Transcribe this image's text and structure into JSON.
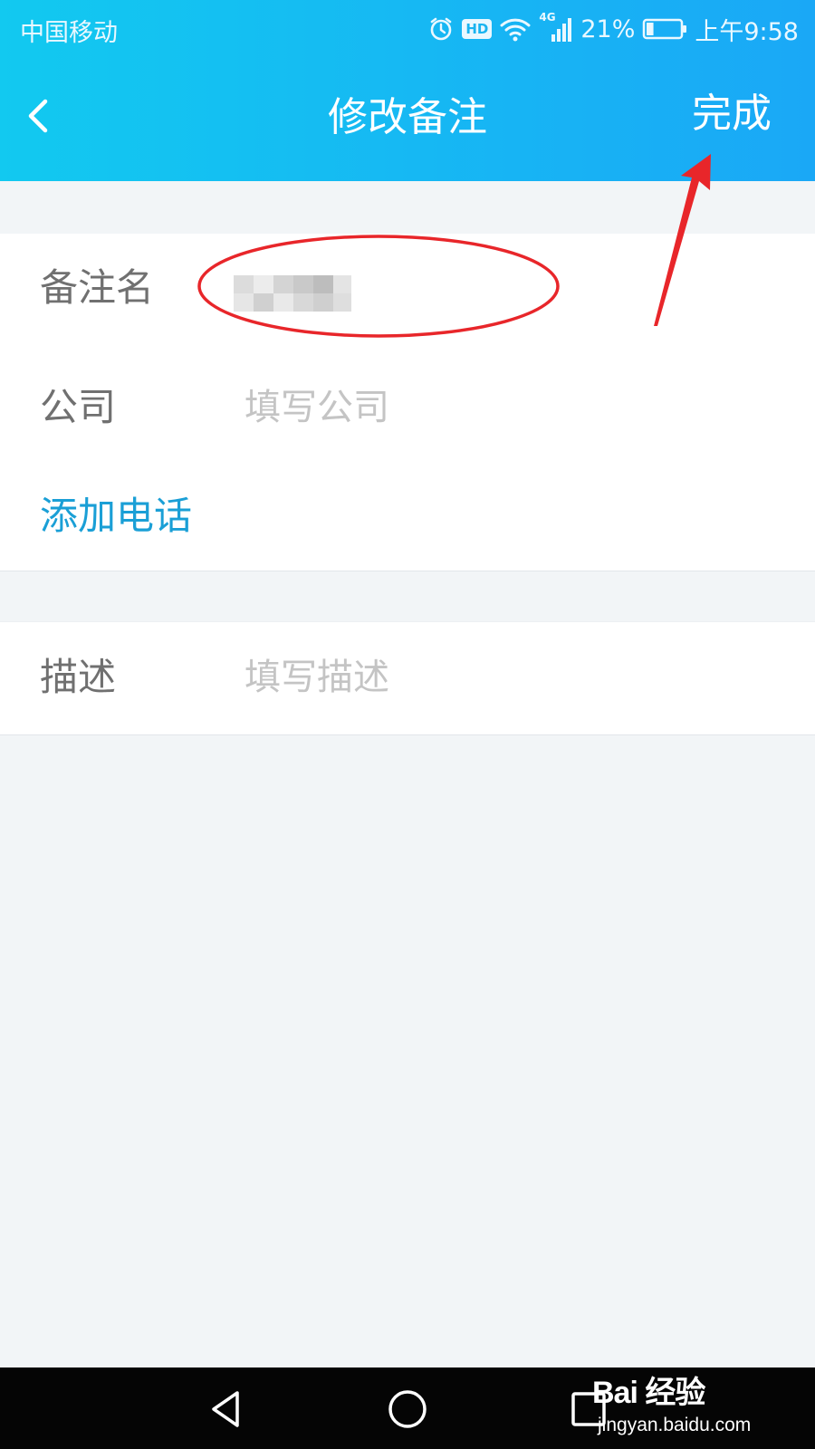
{
  "status_bar": {
    "carrier": "中国移动",
    "network": "4G",
    "hd_badge": "HD",
    "battery_percent": "21%",
    "battery_level": 0.21,
    "time": "上午9:58"
  },
  "nav": {
    "title": "修改备注",
    "done_label": "完成"
  },
  "form": {
    "remark_label": "备注名",
    "company_label": "公司",
    "company_placeholder": "填写公司",
    "add_phone_label": "添加电话",
    "description_label": "描述",
    "description_placeholder": "填写描述"
  },
  "watermark": {
    "main_text": "Bai 经验",
    "url": "jingyan.baidu.com"
  },
  "colors": {
    "header_start": "#12c9f0",
    "header_end": "#1aa8f6",
    "link": "#1a9fd6",
    "annotation": "#e8262a"
  }
}
